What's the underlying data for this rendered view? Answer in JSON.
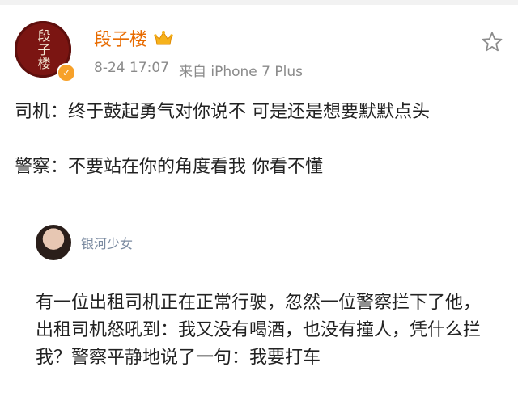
{
  "post": {
    "author": {
      "name": "段子楼",
      "avatar_text": "段子楼",
      "verified_icon": "verified-badge-icon",
      "vip_icon": "crown-vip-icon"
    },
    "timestamp": "8-24 17:07",
    "source": "来自 iPhone 7 Plus",
    "favorite_icon": "star-outline-icon",
    "paragraphs": [
      "司机：终于鼓起勇气对你说不 可是还是想要默默点头",
      "警察：不要站在你的角度看我 你看不懂"
    ]
  },
  "quote": {
    "author": "银河少女",
    "text": "有一位出租司机正在正常行驶，忽然一位警察拦下了他，出租司机怒吼到：我又没有喝酒，也没有撞人，凭什么拦我？警察平静地说了一句：我要打车"
  },
  "colors": {
    "username": "#e86b00",
    "meta": "#8a8a8a",
    "quote_name": "#7a8aa0",
    "avatar_bg": "#7b1512"
  }
}
